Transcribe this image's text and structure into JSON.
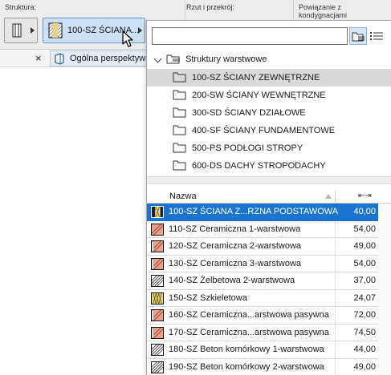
{
  "toolbar": {
    "structure_label": "Struktura:",
    "projection_label": "Rzut i przekrój:",
    "story_label": "Powiązanie z kondygnacjami",
    "composite_button_label": "100-SZ ŚCIANA..."
  },
  "view_tab": {
    "close_symbol": "×",
    "label": "Ogólna perspektywa"
  },
  "popup": {
    "search": {
      "value": "",
      "placeholder": ""
    },
    "tree": {
      "root_label": "Struktury warstwowe",
      "items": [
        {
          "label": "100-SZ ŚCIANY ZEWNĘTRZNE",
          "selected": true
        },
        {
          "label": "200-SW ŚCIANY WEWNĘTRZNE",
          "selected": false
        },
        {
          "label": "300-SD ŚCIANY DZIAŁOWE",
          "selected": false
        },
        {
          "label": "400-SF ŚCIANY FUNDAMENTOWE",
          "selected": false
        },
        {
          "label": "500-PS PODŁOGI STROPY",
          "selected": false
        },
        {
          "label": "600-DS DACHY STROPODACHY",
          "selected": false
        }
      ]
    },
    "table": {
      "col_name": "Nazwa",
      "col_thickness_icon": "⇤⇥",
      "rows": [
        {
          "name": "100-SZ ŚCIANA Z...RZNA PODSTAWOWA",
          "thickness": "40,00",
          "selected": true,
          "pattern": "blue-cross"
        },
        {
          "name": "110-SZ Ceramiczna 1-warstwowa",
          "thickness": "54,00",
          "selected": false,
          "pattern": "brick"
        },
        {
          "name": "120-SZ Ceramiczna 2-warstwowa",
          "thickness": "49,00",
          "selected": false,
          "pattern": "brick"
        },
        {
          "name": "130-SZ Ceramiczna  3-warstwowa",
          "thickness": "54,00",
          "selected": false,
          "pattern": "brick"
        },
        {
          "name": "140-SZ Żelbetowa  2-warstwowa",
          "thickness": "37,00",
          "selected": false,
          "pattern": "hatch-diag"
        },
        {
          "name": "150-SZ Szkieletowa",
          "thickness": "24,07",
          "selected": false,
          "pattern": "insulation"
        },
        {
          "name": "160-SZ Ceramiczna...arstwowa pasywna",
          "thickness": "72,00",
          "selected": false,
          "pattern": "brick"
        },
        {
          "name": "170-SZ Ceramiczna...arstwowa pasywna",
          "thickness": "74,50",
          "selected": false,
          "pattern": "brick"
        },
        {
          "name": "180-SZ Beton komórkowy 1-warstwowa",
          "thickness": "44,00",
          "selected": false,
          "pattern": "hatch-diag"
        },
        {
          "name": "190-SZ Beton komórkowy 2-warstwowa",
          "thickness": "49,00",
          "selected": false,
          "pattern": "hatch-diag"
        }
      ]
    }
  },
  "colors": {
    "selection_blue": "#1c74d0",
    "tree_selection_gray": "#d9d9d9",
    "brick_fill": "#e8a08a",
    "insulation_fill": "#e9d27a"
  },
  "icons": {
    "structure_type": "wall-structure-icon",
    "composite": "composite-wall-icon",
    "cursor": "mouse-cursor-icon",
    "view": "perspective-view-icon",
    "tree_root": "folders-icon",
    "tree_folder": "folder-icon",
    "folder_view": "folder-view-icon",
    "list_view": "list-view-icon"
  }
}
